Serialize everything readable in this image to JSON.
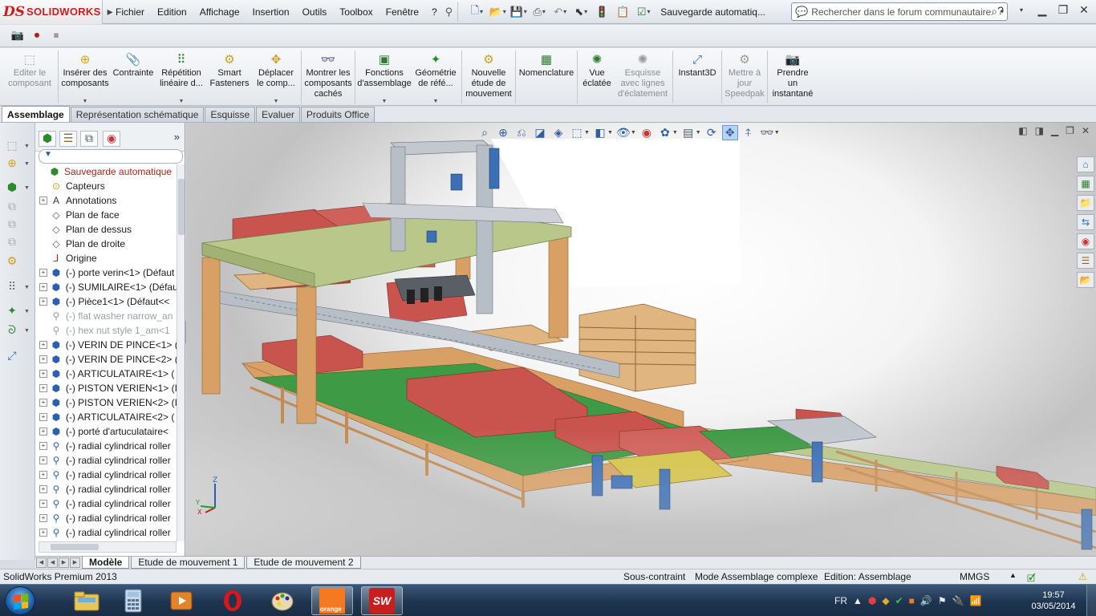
{
  "app": {
    "name": "SOLIDWORKS",
    "logo_mark": "DS"
  },
  "menus": [
    "Fichier",
    "Edition",
    "Affichage",
    "Insertion",
    "Outils",
    "Toolbox",
    "Fenêtre",
    "?"
  ],
  "document_title": "Sauvegarde automatiq...",
  "search": {
    "placeholder": "Rechercher dans le forum communautaire"
  },
  "command_manager": [
    {
      "label": "Editer le\ncomposant",
      "icon": "edit-component-icon",
      "disabled": true
    },
    {
      "label": "Insérer des\ncomposants",
      "icon": "insert-components-icon",
      "dropdown": true
    },
    {
      "label": "Contrainte",
      "icon": "mate-icon"
    },
    {
      "label": "Répétition\nlinéaire d...",
      "icon": "linear-pattern-icon",
      "dropdown": true
    },
    {
      "label": "Smart\nFasteners",
      "icon": "smart-fasteners-icon"
    },
    {
      "label": "Déplacer\nle comp...",
      "icon": "move-component-icon",
      "dropdown": true
    },
    {
      "label": "Montrer les\ncomposants\ncachés",
      "icon": "show-hidden-icon"
    },
    {
      "label": "Fonctions\nd'assemblage",
      "icon": "assembly-features-icon",
      "dropdown": true
    },
    {
      "label": "Géométrie\nde réfé...",
      "icon": "reference-geometry-icon",
      "dropdown": true
    },
    {
      "label": "Nouvelle\nétude de\nmouvement",
      "icon": "motion-study-icon"
    },
    {
      "label": "Nomenclature",
      "icon": "bom-icon"
    },
    {
      "label": "Vue\néclatée",
      "icon": "exploded-view-icon"
    },
    {
      "label": "Esquisse\navec lignes\nd'éclatement",
      "icon": "explode-line-sketch-icon",
      "disabled": true
    },
    {
      "label": "Instant3D",
      "icon": "instant3d-icon"
    },
    {
      "label": "Mettre à\njour\nSpeedpak",
      "icon": "speedpak-icon",
      "disabled": true
    },
    {
      "label": "Prendre\nun\ninstantané",
      "icon": "snapshot-icon"
    }
  ],
  "cm_tabs": [
    "Assemblage",
    "Représentation schématique",
    "Esquisse",
    "Evaluer",
    "Produits Office"
  ],
  "cm_active_tab": "Assemblage",
  "tree": [
    {
      "label": "Sauvegarde automatique",
      "icon": "assembly-icon",
      "type": "root"
    },
    {
      "label": "Capteurs",
      "icon": "sensor-icon",
      "expand": false
    },
    {
      "label": "Annotations",
      "icon": "annotations-icon",
      "expand": true
    },
    {
      "label": "Plan de face",
      "icon": "plane-icon",
      "expand": false
    },
    {
      "label": "Plan de dessus",
      "icon": "plane-icon",
      "expand": false
    },
    {
      "label": "Plan de droite",
      "icon": "plane-icon",
      "expand": false
    },
    {
      "label": "Origine",
      "icon": "origin-icon",
      "expand": false
    },
    {
      "label": "(-) porte verin<1> (Défaut",
      "icon": "subassembly-icon",
      "expand": true
    },
    {
      "label": "(-) SUMILAIRE<1> (Défau",
      "icon": "subassembly-icon",
      "expand": true
    },
    {
      "label": "(-) Pièce1<1> (Défaut<<",
      "icon": "subassembly-icon",
      "expand": true
    },
    {
      "label": "(-) flat washer narrow_an",
      "icon": "toolbox-part-icon",
      "expand": false,
      "suppressed": true
    },
    {
      "label": "(-) hex nut style 1_am<1",
      "icon": "toolbox-part-icon",
      "expand": false,
      "suppressed": true
    },
    {
      "label": "(-) VERIN DE PINCE<1> (",
      "icon": "subassembly-icon",
      "expand": true
    },
    {
      "label": "(-) VERIN DE PINCE<2> (",
      "icon": "subassembly-icon",
      "expand": true
    },
    {
      "label": "(-) ARTICULATAIRE<1> (",
      "icon": "subassembly-icon",
      "expand": true
    },
    {
      "label": "(-) PISTON VERIEN<1> (I",
      "icon": "subassembly-icon",
      "expand": true
    },
    {
      "label": "(-) PISTON VERIEN<2> (I",
      "icon": "subassembly-icon",
      "expand": true
    },
    {
      "label": "(-) ARTICULATAIRE<2> (",
      "icon": "subassembly-icon",
      "expand": true
    },
    {
      "label": "(-) porté d'artuculataire<",
      "icon": "subassembly-icon",
      "expand": true
    },
    {
      "label": "(-) radial cylindrical roller",
      "icon": "bearing-icon",
      "expand": true
    },
    {
      "label": "(-) radial cylindrical roller",
      "icon": "bearing-icon",
      "expand": true
    },
    {
      "label": "(-) radial cylindrical roller",
      "icon": "bearing-icon",
      "expand": true
    },
    {
      "label": "(-) radial cylindrical roller",
      "icon": "bearing-icon",
      "expand": true
    },
    {
      "label": "(-) radial cylindrical roller",
      "icon": "bearing-icon",
      "expand": true
    },
    {
      "label": "(-) radial cylindrical roller",
      "icon": "bearing-icon",
      "expand": true
    },
    {
      "label": "(-) radial cylindrical roller",
      "icon": "bearing-icon",
      "expand": true
    }
  ],
  "model_tabs": [
    "Modèle",
    "Etude de mouvement 1",
    "Etude de mouvement 2"
  ],
  "model_active_tab": "Modèle",
  "status": {
    "product": "SolidWorks Premium 2013",
    "constraint": "Sous-contraint",
    "mode": "Mode Assemblage complexe",
    "editing": "Edition: Assemblage",
    "units": "MMGS"
  },
  "triad": {
    "x": "X",
    "y": "Y",
    "z": "Z"
  },
  "taskbar": {
    "apps": [
      "explorer-icon",
      "calculator-icon",
      "media-player-icon",
      "opera-icon",
      "paint-icon",
      "orange-icon",
      "solidworks-icon"
    ],
    "orange_label": "orange",
    "sw_label": "SW",
    "language": "FR",
    "time": "19:57",
    "date": "03/05/2014"
  },
  "colors": {
    "brand_red": "#d21a1a",
    "wood": "#d9a066",
    "frame_green": "#b9c88a",
    "brick": "#c9544e",
    "motor_blue": "#3c6fb4",
    "floor_green": "#3f9a45",
    "steel": "#b8bec6"
  }
}
